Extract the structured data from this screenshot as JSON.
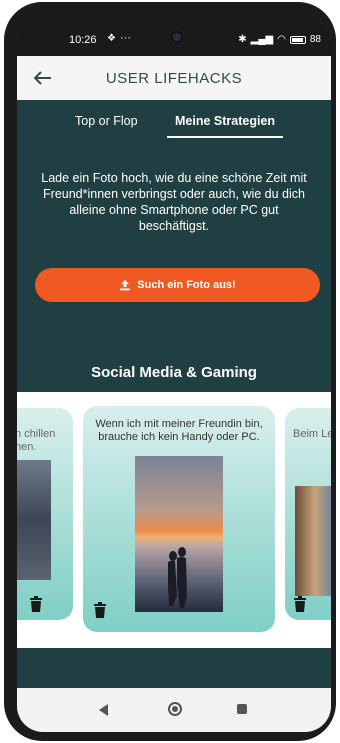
{
  "status_bar": {
    "time": "10:26",
    "notification_glyph": "❖",
    "dots": "···",
    "battery": "88"
  },
  "app_bar": {
    "title": "USER LIFEHACKS",
    "back_icon": "arrow-left-icon"
  },
  "tabs": [
    {
      "label": "Top or Flop",
      "active": false
    },
    {
      "label": "Meine Strategien",
      "active": true
    }
  ],
  "description": "Lade ein Foto hoch, wie du eine schöne Zeit mit Freund*innen verbringst oder auch, wie du dich alleine ohne Smartphone oder PC gut beschäftigst.",
  "upload_button": {
    "label": "Such ein Foto aus!",
    "icon": "upload-icon",
    "color": "#f05a22"
  },
  "section": {
    "title": "Social Media & Gaming"
  },
  "cards": [
    {
      "caption": "n chillen\nnen.",
      "position": "left"
    },
    {
      "caption": "Wenn ich mit meiner Freundin bin, brauche ich kein Handy oder PC.",
      "position": "center"
    },
    {
      "caption": "Beim Les",
      "position": "right"
    }
  ],
  "colors": {
    "background": "#1f3f42",
    "accent": "#f05a22",
    "title": "#2b4d50"
  }
}
